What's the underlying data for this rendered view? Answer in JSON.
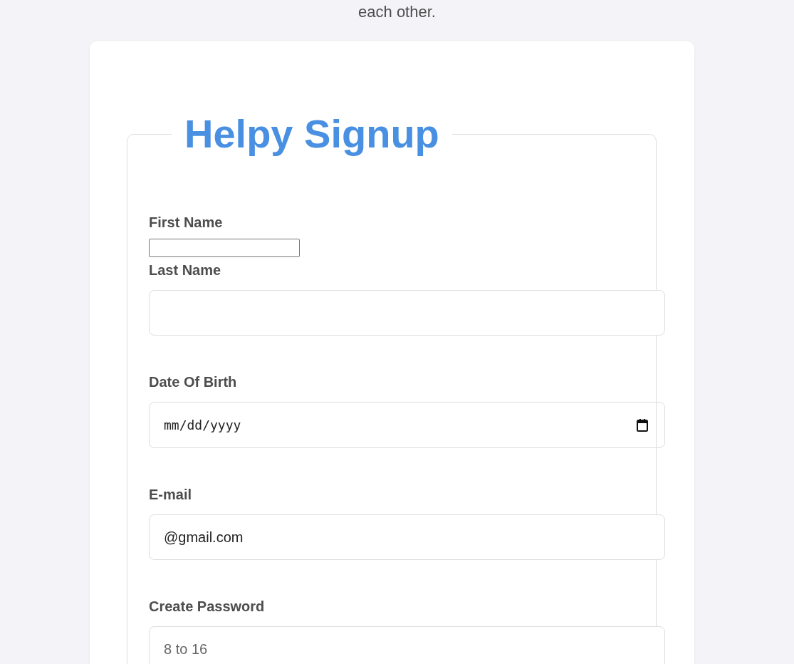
{
  "intro": {
    "text": "each other."
  },
  "form": {
    "title": "Helpy Signup",
    "fields": [
      {
        "kind": "plain",
        "label": "First Name"
      },
      {
        "kind": "text",
        "label": "Last Name"
      },
      {
        "kind": "date",
        "label": "Date Of Birth",
        "placeholder": "mm/dd/yyyy"
      },
      {
        "kind": "text",
        "label": "E-mail",
        "value": "@gmail.com"
      },
      {
        "kind": "text",
        "label": "Create Password",
        "placeholder": "8 to 16"
      }
    ]
  }
}
